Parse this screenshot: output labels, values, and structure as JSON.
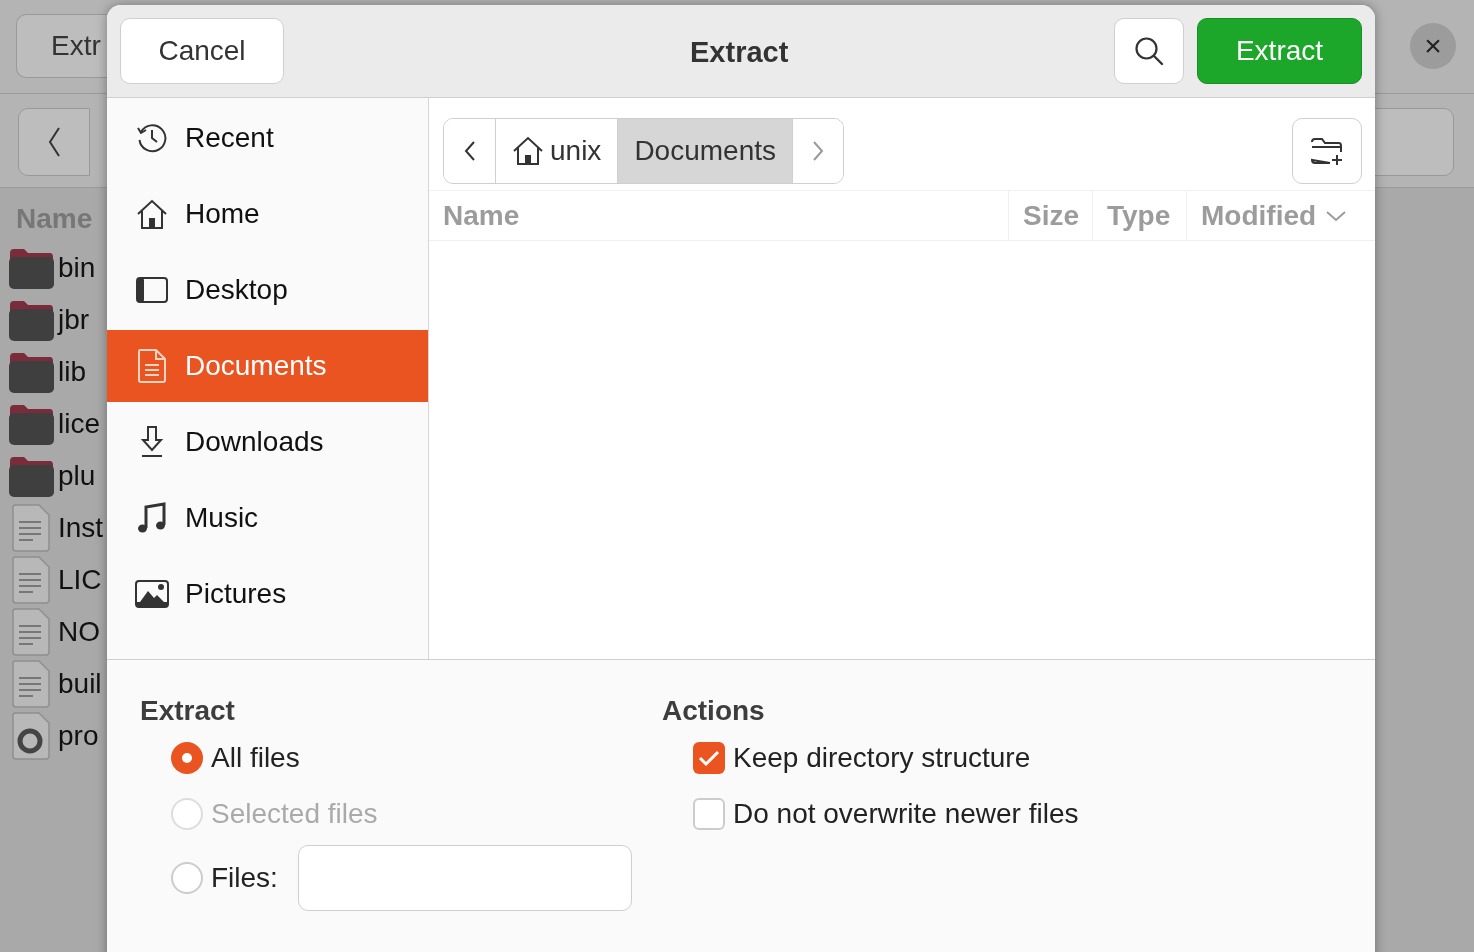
{
  "background_window": {
    "extract_button": "Extr",
    "column_header": "Name",
    "close_button": "×",
    "files": [
      {
        "name": "bin",
        "kind": "folder"
      },
      {
        "name": "jbr",
        "kind": "folder"
      },
      {
        "name": "lib",
        "kind": "folder"
      },
      {
        "name": "lice",
        "kind": "folder"
      },
      {
        "name": "plu",
        "kind": "folder"
      },
      {
        "name": "Inst",
        "kind": "text"
      },
      {
        "name": "LIC",
        "kind": "text"
      },
      {
        "name": "NO",
        "kind": "text"
      },
      {
        "name": "buil",
        "kind": "text"
      },
      {
        "name": "pro",
        "kind": "disc"
      }
    ]
  },
  "dialog": {
    "cancel_button": "Cancel",
    "title": "Extract",
    "extract_button": "Extract"
  },
  "sidebar": {
    "items": [
      {
        "label": "Recent",
        "kind": "recent",
        "selected": false
      },
      {
        "label": "Home",
        "kind": "home",
        "selected": false
      },
      {
        "label": "Desktop",
        "kind": "desktop",
        "selected": false
      },
      {
        "label": "Documents",
        "kind": "document",
        "selected": true
      },
      {
        "label": "Downloads",
        "kind": "download",
        "selected": false
      },
      {
        "label": "Music",
        "kind": "music",
        "selected": false
      },
      {
        "label": "Pictures",
        "kind": "picture",
        "selected": false
      }
    ]
  },
  "path_bar": {
    "segments": [
      {
        "label": "unix",
        "kind": "home",
        "selected": false
      },
      {
        "label": "Documents",
        "kind": "folder",
        "selected": true
      }
    ]
  },
  "file_list": {
    "columns": [
      {
        "label": "Name",
        "sorted": false
      },
      {
        "label": "Size",
        "sorted": false
      },
      {
        "label": "Type",
        "sorted": false
      },
      {
        "label": "Modified",
        "sorted": true
      }
    ]
  },
  "options": {
    "extract": {
      "heading": "Extract",
      "choices": [
        {
          "label": "All files",
          "selected": true,
          "disabled": false,
          "kind": "plain"
        },
        {
          "label": "Selected files",
          "selected": false,
          "disabled": true,
          "kind": "plain"
        },
        {
          "label": "Files:",
          "selected": false,
          "disabled": false,
          "kind": "with_field"
        }
      ]
    },
    "actions": {
      "heading": "Actions",
      "checks": [
        {
          "label": "Keep directory structure",
          "checked": true
        },
        {
          "label": "Do not overwrite newer files",
          "checked": false
        }
      ]
    }
  }
}
